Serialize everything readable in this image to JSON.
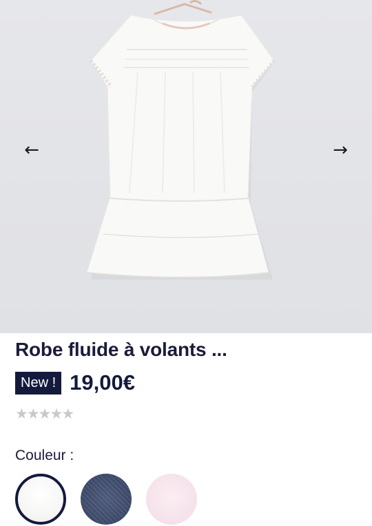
{
  "gallery": {
    "prev_icon": "←",
    "next_icon": "→"
  },
  "product": {
    "title": "Robe fluide à volants ...",
    "badge": "New !",
    "price": "19,00€",
    "rating_stars": 5,
    "rating_value": 0
  },
  "colors": {
    "label": "Couleur :",
    "options": [
      {
        "name": "white",
        "color": "#f7f7f5",
        "selected": true
      },
      {
        "name": "navy",
        "color": "#3b4766",
        "selected": false
      },
      {
        "name": "pink",
        "color": "#f5e1e9",
        "selected": false
      }
    ]
  },
  "theme": {
    "accent": "#141a3c",
    "star_inactive": "#c9c9c9"
  }
}
